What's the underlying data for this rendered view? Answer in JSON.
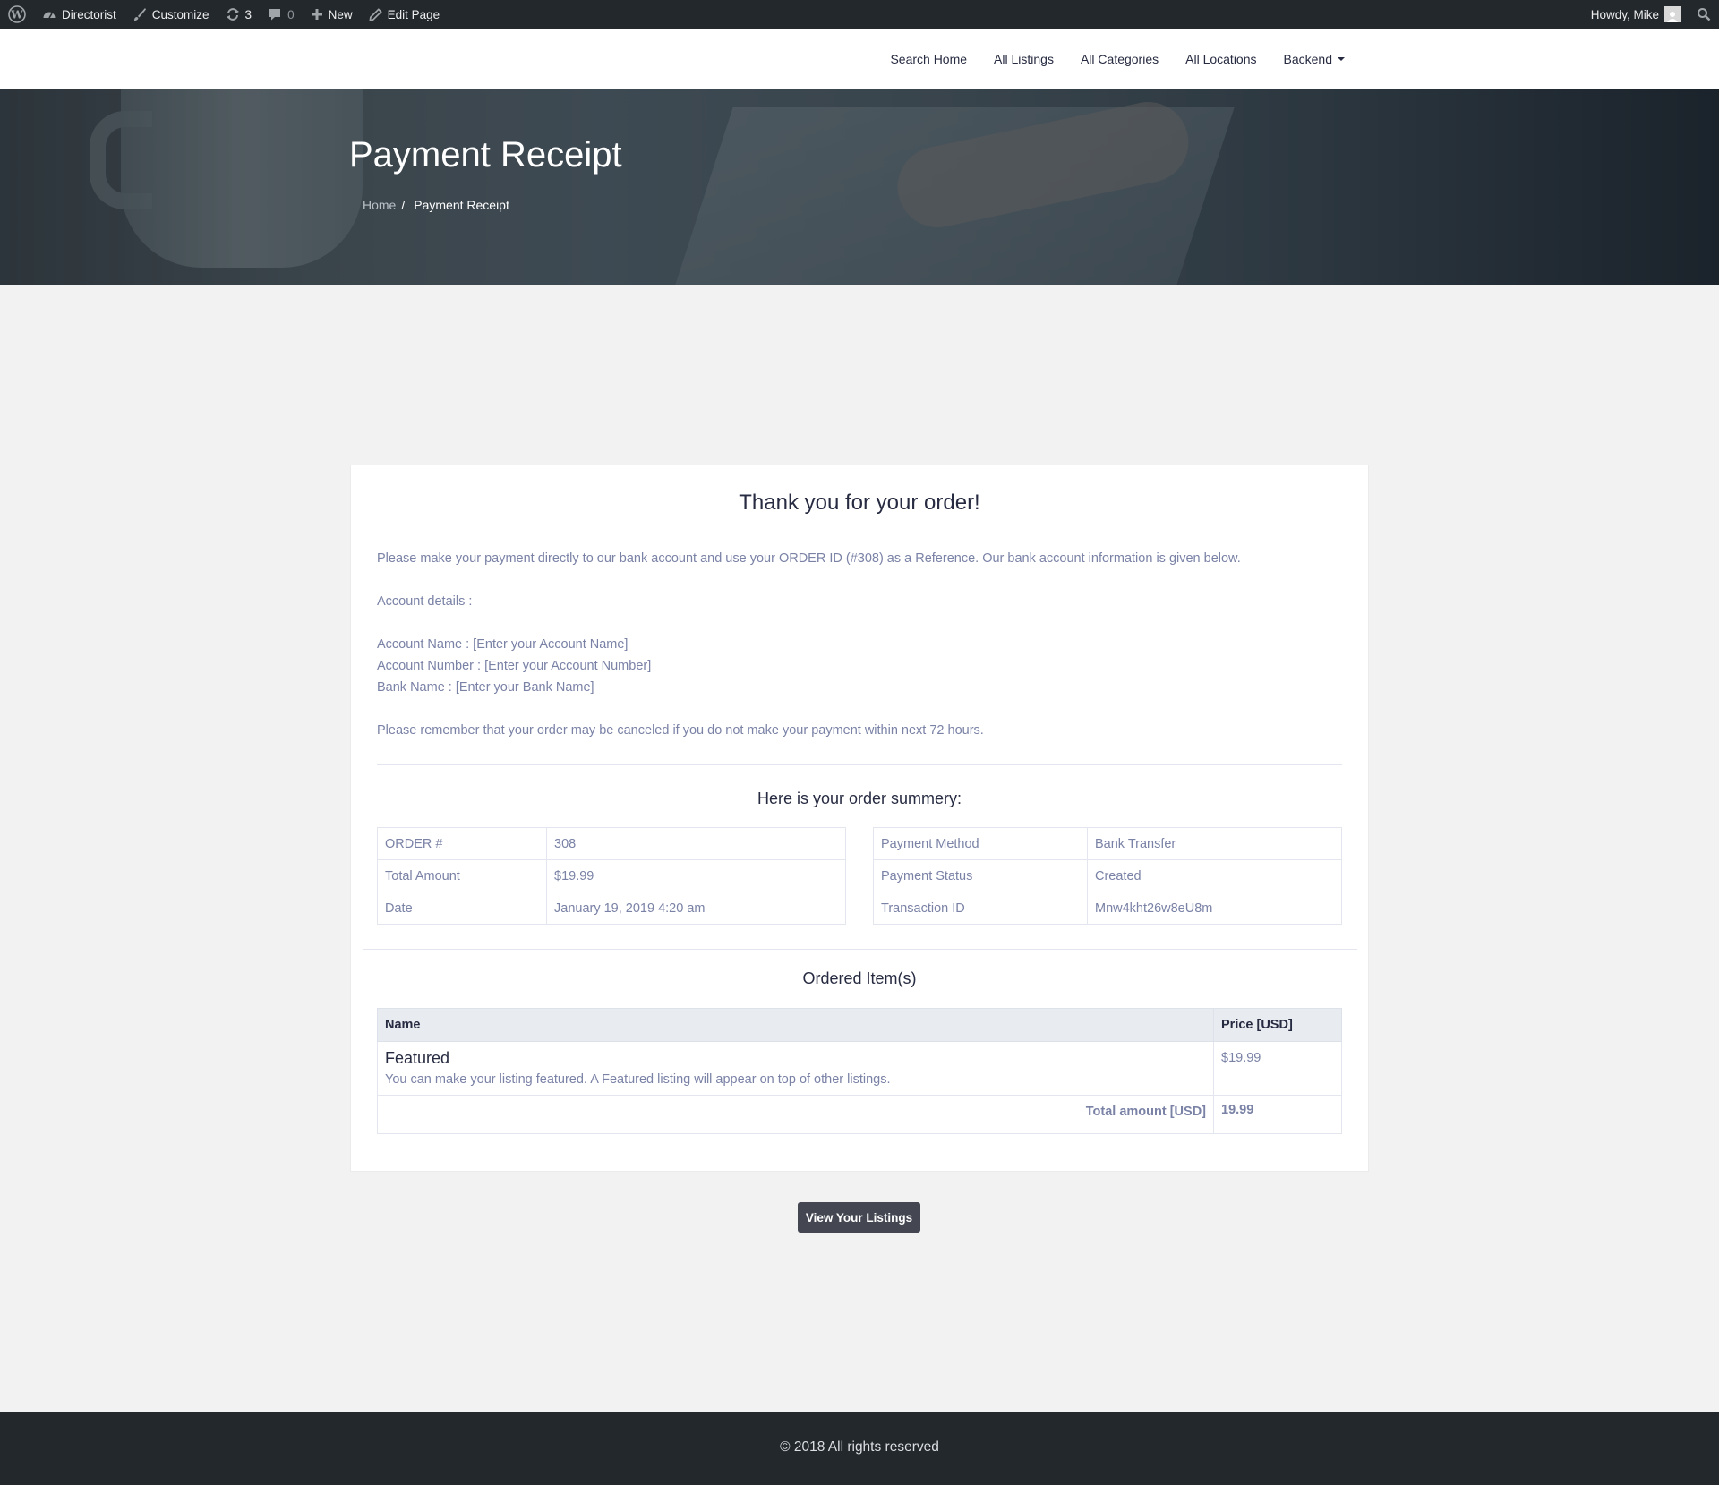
{
  "adminbar": {
    "site_name": "Directorist",
    "customize": "Customize",
    "updates_count": "3",
    "comments_count": "0",
    "new_label": "New",
    "edit_page": "Edit Page",
    "howdy": "Howdy, Mike"
  },
  "nav": {
    "items": [
      "Search Home",
      "All Listings",
      "All Categories",
      "All Locations",
      "Backend"
    ]
  },
  "hero": {
    "title": "Payment Receipt",
    "breadcrumb_home": "Home",
    "breadcrumb_sep": "/",
    "breadcrumb_current": "Payment Receipt"
  },
  "receipt": {
    "title": "Thank you for your order!",
    "intro": "Please make your payment directly to our bank account and use your ORDER ID (#308) as a Reference. Our bank account information is given below.",
    "account_details": "Account details :",
    "account_name": "Account Name : [Enter your Account Name]",
    "account_number": "Account Number : [Enter your Account Number]",
    "bank_name": "Bank Name : [Enter your Bank Name]",
    "reminder": "Please remember that your order may be canceled if you do not make your payment within next 72 hours.",
    "summary_title": "Here is your order summery:",
    "summary_left": [
      {
        "label": "ORDER #",
        "value": "308"
      },
      {
        "label": "Total Amount",
        "value": "$19.99"
      },
      {
        "label": "Date",
        "value": "January 19, 2019 4:20 am"
      }
    ],
    "summary_right": [
      {
        "label": "Payment Method",
        "value": "Bank Transfer"
      },
      {
        "label": "Payment Status",
        "value": "Created"
      },
      {
        "label": "Transaction ID",
        "value": "Mnw4kht26w8eU8m"
      }
    ],
    "items_title": "Ordered Item(s)",
    "items_headers": {
      "name": "Name",
      "price": "Price [USD]"
    },
    "items": [
      {
        "name": "Featured",
        "description": "You can make your listing featured. A Featured listing will appear on top of other listings.",
        "price": "$19.99"
      }
    ],
    "total_label": "Total amount [USD]",
    "total_value": "19.99"
  },
  "button": {
    "label": "View Your Listings"
  },
  "footer": {
    "text": "© 2018 All rights reserved"
  },
  "colors": {
    "admin_bar": "#23282d",
    "button": "#444752",
    "muted_text": "#7a82a6",
    "dark_text": "#272b41"
  }
}
